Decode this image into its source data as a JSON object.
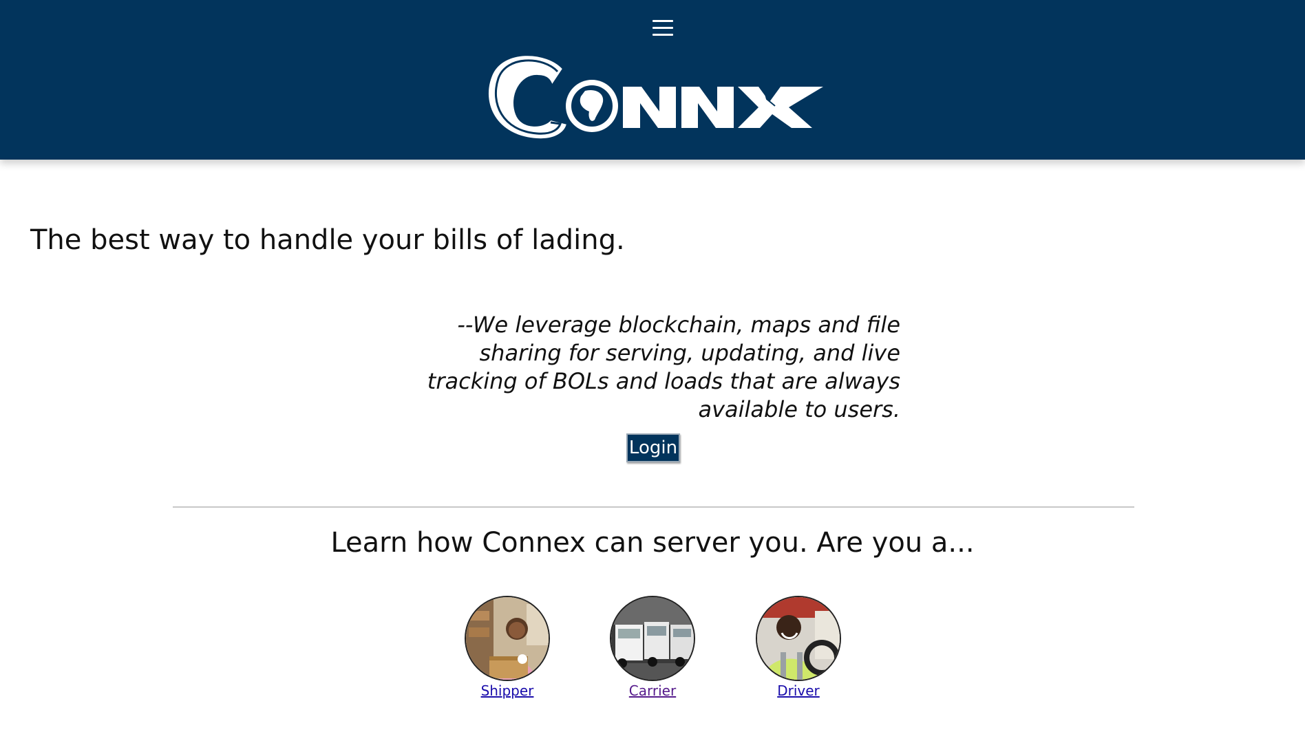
{
  "header": {
    "menu_icon": "hamburger-menu-icon",
    "logo_text": "CONNX",
    "background_color": "#02345c"
  },
  "main": {
    "headline": "The best way to handle your bills of lading.",
    "quote": "--We leverage blockchain, maps and file sharing for serving, updating, and live tracking of BOLs and loads that are always available to users.",
    "login_label": "Login",
    "learn_heading": "Learn how Connex can server you. Are you a..."
  },
  "roles": [
    {
      "label": "Shipper"
    },
    {
      "label": "Carrier"
    },
    {
      "label": "Driver"
    }
  ]
}
